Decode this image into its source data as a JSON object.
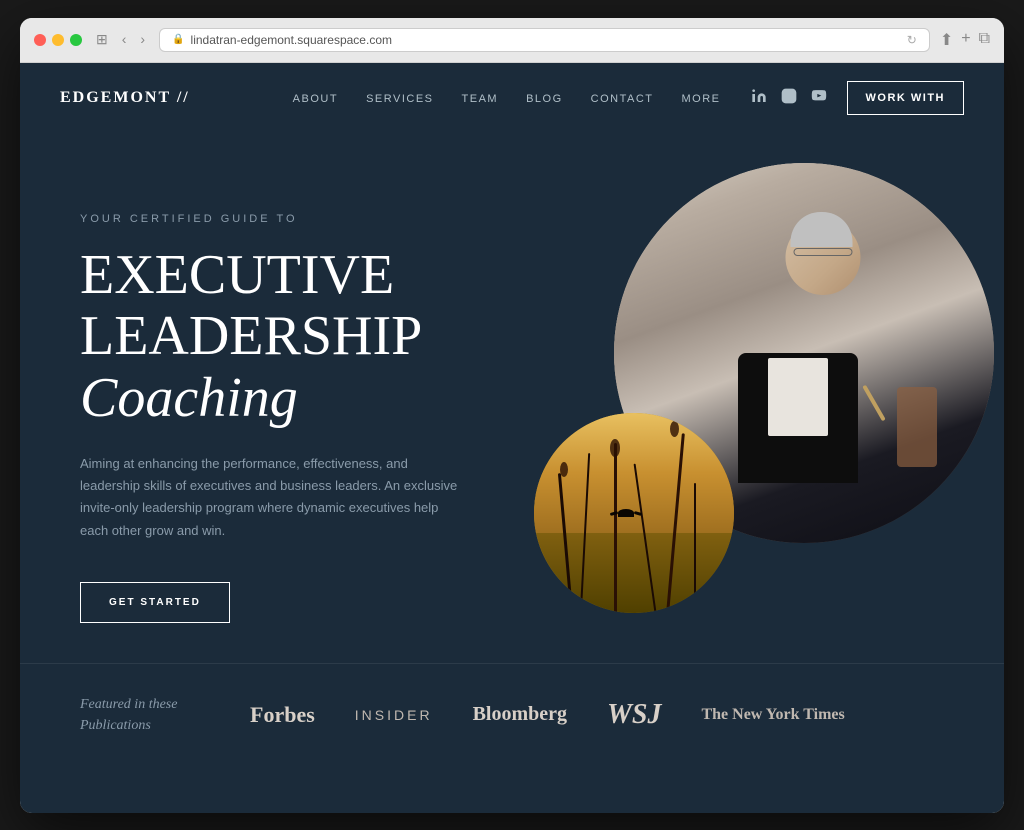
{
  "browser": {
    "url": "lindatran-edgemont.squarespace.com",
    "dots": [
      "red",
      "yellow",
      "green"
    ]
  },
  "nav": {
    "logo": "EDGEMONT //",
    "links": [
      "ABOUT",
      "SERVICES",
      "TEAM",
      "BLOG",
      "CONTACT",
      "MORE"
    ],
    "social": [
      "linkedin",
      "instagram",
      "youtube"
    ],
    "cta": "WORK WITH"
  },
  "hero": {
    "subtitle": "YOUR CERTIFIED GUIDE TO",
    "title_line1": "EXECUTIVE",
    "title_line2": "LEADERSHIP",
    "title_italic": "Coaching",
    "description": "Aiming at enhancing the performance, effectiveness, and leadership skills of executives and business leaders. An exclusive invite-only leadership program where dynamic executives help each other grow and win.",
    "cta": "GET STARTED"
  },
  "publications": {
    "label_line1": "Featured in these",
    "label_line2": "Publications",
    "logos": [
      {
        "name": "Forbes",
        "class": "forbes"
      },
      {
        "name": "INSIDER",
        "class": "insider"
      },
      {
        "name": "Bloomberg",
        "class": "bloomberg"
      },
      {
        "name": "WSJ",
        "class": "wsj"
      },
      {
        "name": "The New York Times",
        "class": "nyt"
      }
    ]
  },
  "colors": {
    "background": "#1b2b3a",
    "text_primary": "#ffffff",
    "text_secondary": "#8a9baa",
    "accent": "#ffffff"
  }
}
